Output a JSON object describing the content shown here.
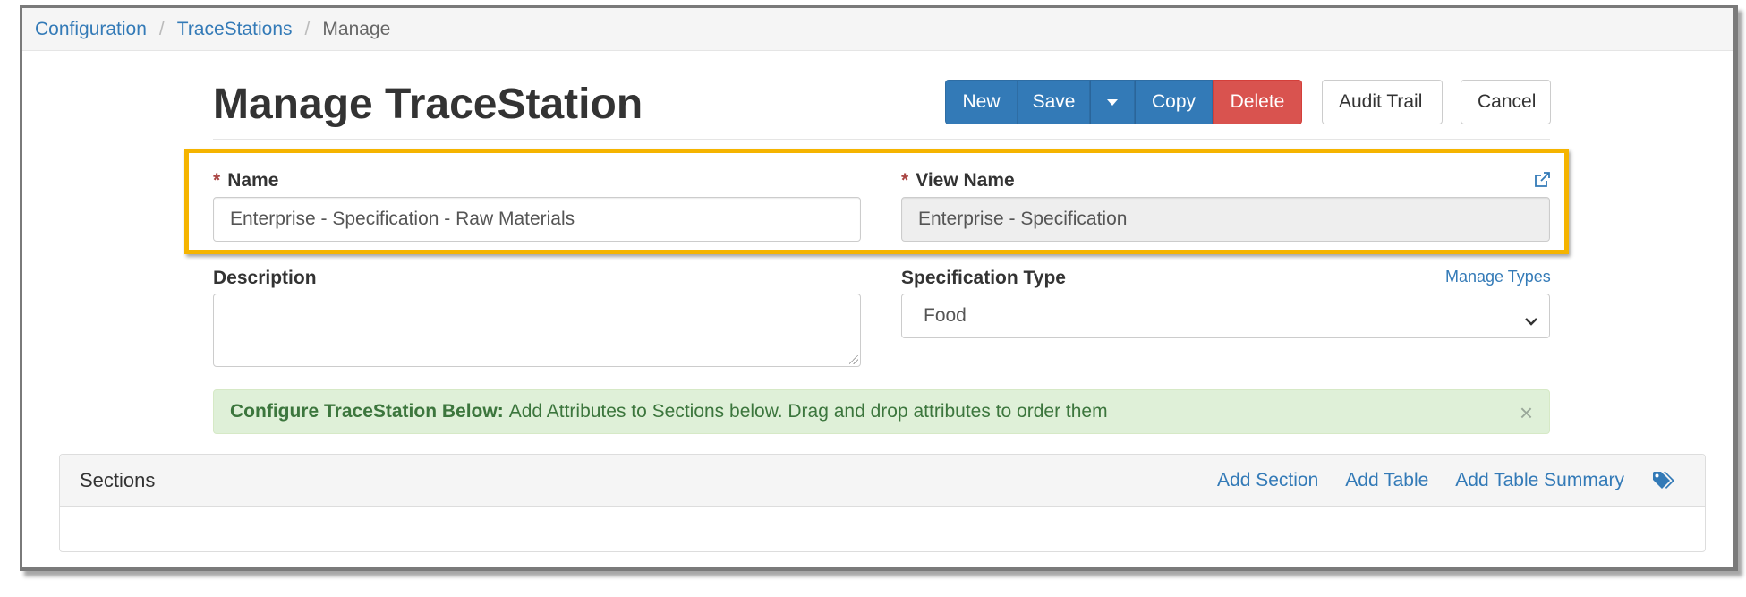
{
  "breadcrumb": {
    "items": [
      "Configuration",
      "TraceStations"
    ],
    "active": "Manage",
    "separator": "/"
  },
  "page": {
    "title": "Manage TraceStation"
  },
  "toolbar": {
    "new_label": "New",
    "save_label": "Save",
    "copy_label": "Copy",
    "delete_label": "Delete",
    "audit_trail_label": "Audit Trail",
    "cancel_label": "Cancel"
  },
  "form": {
    "required_marker": "*",
    "name": {
      "label": "Name",
      "value": "Enterprise - Specification - Raw Materials"
    },
    "view_name": {
      "label": "View Name",
      "value": "Enterprise - Specification"
    },
    "description": {
      "label": "Description",
      "value": ""
    },
    "specification_type": {
      "label": "Specification Type",
      "selected": "Food",
      "manage_link": "Manage Types"
    }
  },
  "alert": {
    "heading": "Configure TraceStation Below:",
    "message": "Add Attributes to Sections below. Drag and drop attributes to order them",
    "close": "×"
  },
  "sections_panel": {
    "title": "Sections",
    "add_section": "Add Section",
    "add_table": "Add Table",
    "add_table_summary": "Add Table Summary"
  },
  "icons": {
    "external_link": "external-link-icon",
    "tags": "tags-icon",
    "caret": "caret-down-icon",
    "chevron": "chevron-down-icon"
  },
  "colors": {
    "primary": "#337ab7",
    "danger": "#d9534f",
    "highlight": "#f5b400",
    "alert_bg": "#dff0d8",
    "alert_text": "#3c763d"
  }
}
